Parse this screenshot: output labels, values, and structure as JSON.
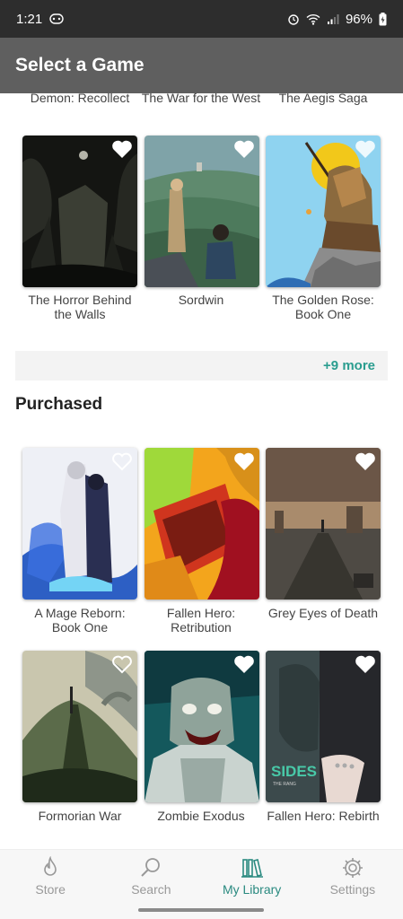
{
  "status_bar": {
    "time": "1:21",
    "battery": "96%"
  },
  "app_bar": {
    "title": "Select a Game"
  },
  "top_titles": [
    "Demon: Recollect",
    "The War for the West",
    "The Aegis Saga"
  ],
  "row1": [
    {
      "title": "The Horror Behind the Walls",
      "favorited": false
    },
    {
      "title": "Sordwin",
      "favorited": false
    },
    {
      "title": "The Golden Rose: Book One",
      "favorited": false
    }
  ],
  "more": {
    "label": "+9 more"
  },
  "purchased": {
    "heading": "Purchased",
    "row1": [
      {
        "title": "A Mage Reborn: Book One",
        "favorited": false
      },
      {
        "title": "Fallen Hero: Retribution",
        "favorited": false
      },
      {
        "title": "Grey Eyes of Death",
        "favorited": false
      }
    ],
    "row2": [
      {
        "title": "Formorian War",
        "favorited": false
      },
      {
        "title": "Zombie Exodus",
        "favorited": false
      },
      {
        "title": "Fallen Hero: Rebirth",
        "favorited": false
      }
    ],
    "cover_text": {
      "sides": "SIDES",
      "sides_sub": "THE RANG"
    }
  },
  "nav": {
    "items": [
      {
        "label": "Store",
        "icon": "flame-icon"
      },
      {
        "label": "Search",
        "icon": "search-icon"
      },
      {
        "label": "My Library",
        "icon": "library-icon"
      },
      {
        "label": "Settings",
        "icon": "gear-icon"
      }
    ],
    "active": "My Library",
    "active_color": "#2a8a80",
    "inactive_color": "#999999"
  },
  "colors": {
    "accent": "#2a9d8f",
    "app_bar": "#5f5f5f",
    "status_bar": "#2d2d2d"
  }
}
